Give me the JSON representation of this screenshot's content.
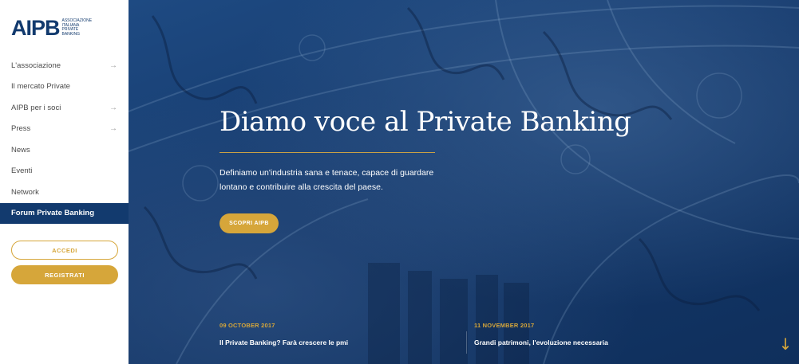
{
  "logo": {
    "mark_a": "AI",
    "mark_p": "P",
    "mark_b": "B",
    "subtitle_lines": [
      "ASSOCIAZIONE",
      "ITALIANA",
      "PRIVATE",
      "BANKING"
    ]
  },
  "sidebar": {
    "items": [
      {
        "label": "L'associazione",
        "has_arrow": true
      },
      {
        "label": "Il mercato Private",
        "has_arrow": false
      },
      {
        "label": "AIPB per i soci",
        "has_arrow": true
      },
      {
        "label": "Press",
        "has_arrow": true
      },
      {
        "label": "News",
        "has_arrow": false
      },
      {
        "label": "Eventi",
        "has_arrow": false
      },
      {
        "label": "Network",
        "has_arrow": false
      },
      {
        "label": "Forum Private Banking",
        "has_arrow": false,
        "active": true
      }
    ],
    "arrow_glyph": "→",
    "login_label": "ACCEDI",
    "register_label": "REGISTRATI"
  },
  "hero": {
    "title": "Diamo voce al Private Banking",
    "description": "Definiamo un'industria sana e tenace, capace di guardare lontano e contribuire alla crescita del paese.",
    "cta_label": "SCOPRI AIPB",
    "scroll_glyph": "↓"
  },
  "news": [
    {
      "date": "09 OCTOBER 2017",
      "title": "Il Private Banking? Farà crescere le pmi"
    },
    {
      "date": "11 NOVEMBER 2017",
      "title": "Grandi patrimoni, l'evoluzione necessaria"
    }
  ],
  "colors": {
    "brand_blue": "#123a6e",
    "accent_gold": "#d6a63a",
    "hero_blue": "#15396b"
  }
}
